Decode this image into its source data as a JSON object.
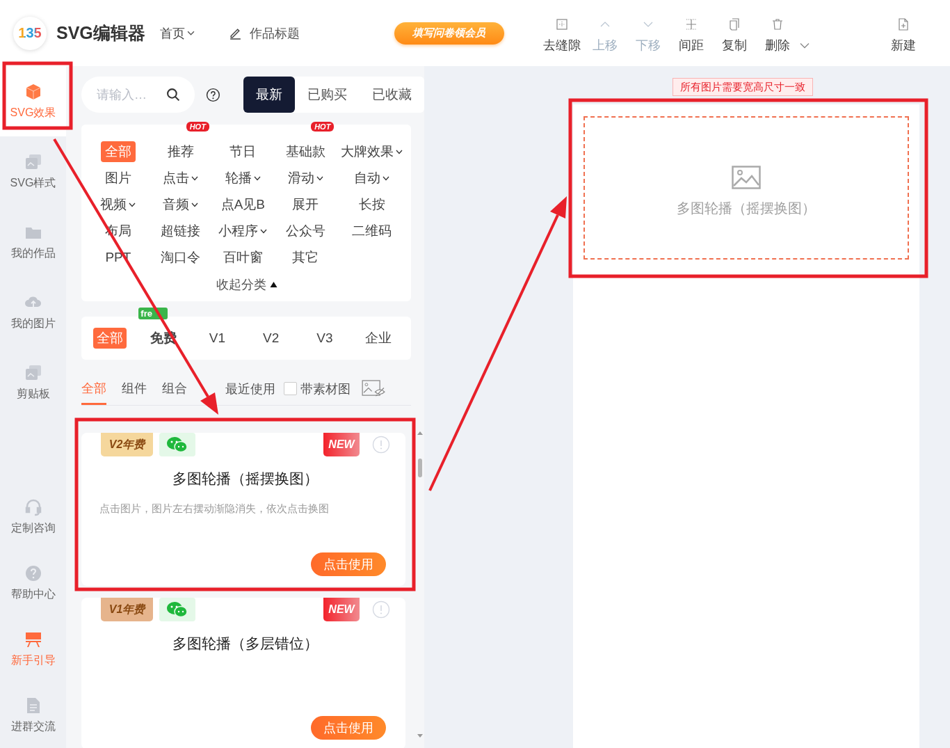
{
  "header": {
    "logo": "135",
    "app_name": "SVG编辑器",
    "home_menu": "首页",
    "title_field": "作品标题",
    "promo": "填写问卷领会员"
  },
  "toolbar": [
    {
      "kind": "gap",
      "label": "去缝隙",
      "disabled": false,
      "dropdown": false
    },
    {
      "kind": "up",
      "label": "上移",
      "disabled": true,
      "dropdown": false
    },
    {
      "kind": "down",
      "label": "下移",
      "disabled": true,
      "dropdown": false
    },
    {
      "kind": "spacing",
      "label": "间距",
      "disabled": false,
      "dropdown": false
    },
    {
      "kind": "copy",
      "label": "复制",
      "disabled": false,
      "dropdown": false
    },
    {
      "kind": "delete",
      "label": "删除",
      "disabled": false,
      "dropdown": true
    },
    {
      "kind": "new",
      "label": "新建",
      "disabled": false,
      "dropdown": false
    }
  ],
  "sidebar": {
    "items": [
      {
        "kind": "cube",
        "label": "SVG效果",
        "selected": true,
        "highlighted": false
      },
      {
        "kind": "cards",
        "label": "SVG样式",
        "selected": false,
        "highlighted": false
      },
      {
        "kind": "folder",
        "label": "我的作品",
        "selected": false,
        "highlighted": false
      },
      {
        "kind": "cloud",
        "label": "我的图片",
        "selected": false,
        "highlighted": false
      },
      {
        "kind": "cards",
        "label": "剪贴板",
        "selected": false,
        "highlighted": false
      }
    ],
    "bottom_items": [
      {
        "kind": "headset",
        "label": "定制咨询",
        "selected": false,
        "highlighted": false
      },
      {
        "kind": "help",
        "label": "帮助中心",
        "selected": false,
        "highlighted": false
      },
      {
        "kind": "guide",
        "label": "新手引导",
        "selected": false,
        "highlighted": true
      },
      {
        "kind": "doc",
        "label": "进群交流",
        "selected": false,
        "highlighted": false
      }
    ]
  },
  "search": {
    "placeholder": "请输入…"
  },
  "filters": [
    {
      "label": "最新",
      "selected": true
    },
    {
      "label": "已购买",
      "selected": false
    },
    {
      "label": "已收藏",
      "selected": false
    }
  ],
  "categories": [
    {
      "label": "全部",
      "selected": true,
      "dropdown": false
    },
    {
      "label": "推荐",
      "selected": false,
      "dropdown": false,
      "badge": "HOT"
    },
    {
      "label": "节日",
      "selected": false,
      "dropdown": false
    },
    {
      "label": "基础款",
      "selected": false,
      "dropdown": false,
      "badge": "HOT"
    },
    {
      "label": "大牌效果",
      "selected": false,
      "dropdown": true
    },
    {
      "label": "图片",
      "selected": false,
      "dropdown": false
    },
    {
      "label": "点击",
      "selected": false,
      "dropdown": true
    },
    {
      "label": "轮播",
      "selected": false,
      "dropdown": true
    },
    {
      "label": "滑动",
      "selected": false,
      "dropdown": true
    },
    {
      "label": "自动",
      "selected": false,
      "dropdown": true
    },
    {
      "label": "视频",
      "selected": false,
      "dropdown": true
    },
    {
      "label": "音频",
      "selected": false,
      "dropdown": true
    },
    {
      "label": "点A见B",
      "selected": false,
      "dropdown": false
    },
    {
      "label": "展开",
      "selected": false,
      "dropdown": false
    },
    {
      "label": "长按",
      "selected": false,
      "dropdown": false
    },
    {
      "label": "布局",
      "selected": false,
      "dropdown": false
    },
    {
      "label": "超链接",
      "selected": false,
      "dropdown": false
    },
    {
      "label": "小程序",
      "selected": false,
      "dropdown": true
    },
    {
      "label": "公众号",
      "selected": false,
      "dropdown": false
    },
    {
      "label": "二维码",
      "selected": false,
      "dropdown": false
    },
    {
      "label": "PPT",
      "selected": false,
      "dropdown": false
    },
    {
      "label": "淘口令",
      "selected": false,
      "dropdown": false
    },
    {
      "label": "百叶窗",
      "selected": false,
      "dropdown": false
    },
    {
      "label": "其它",
      "selected": false,
      "dropdown": false
    }
  ],
  "collapse": "收起分类",
  "tiers": [
    {
      "label": "全部",
      "selected": true
    },
    {
      "label": "免费",
      "selected": false,
      "badge": "fre"
    },
    {
      "label": "V1",
      "selected": false
    },
    {
      "label": "V2",
      "selected": false
    },
    {
      "label": "V3",
      "selected": false
    },
    {
      "label": "企业",
      "selected": false
    }
  ],
  "tabs": [
    {
      "label": "全部",
      "selected": true
    },
    {
      "label": "组件",
      "selected": false
    },
    {
      "label": "组合",
      "selected": false
    }
  ],
  "recent": "最近使用",
  "with_material": {
    "label": "带素材图",
    "checked": false
  },
  "cards": [
    {
      "tier": "V2年费",
      "color": "#f5d79c",
      "new": "NEW",
      "title": "多图轮播（摇摆换图）",
      "description": "点击图片，图片左右摆动渐隐消失，依次点击换图",
      "button": "点击使用"
    },
    {
      "tier": "V1年费",
      "color": "#e6b48c",
      "new": "NEW",
      "title": "多图轮播（多层错位）",
      "button": "点击使用"
    }
  ],
  "canvas": {
    "notice": "所有图片需要宽高尺寸一致",
    "placeholder": "多图轮播（摇摆换图）"
  }
}
